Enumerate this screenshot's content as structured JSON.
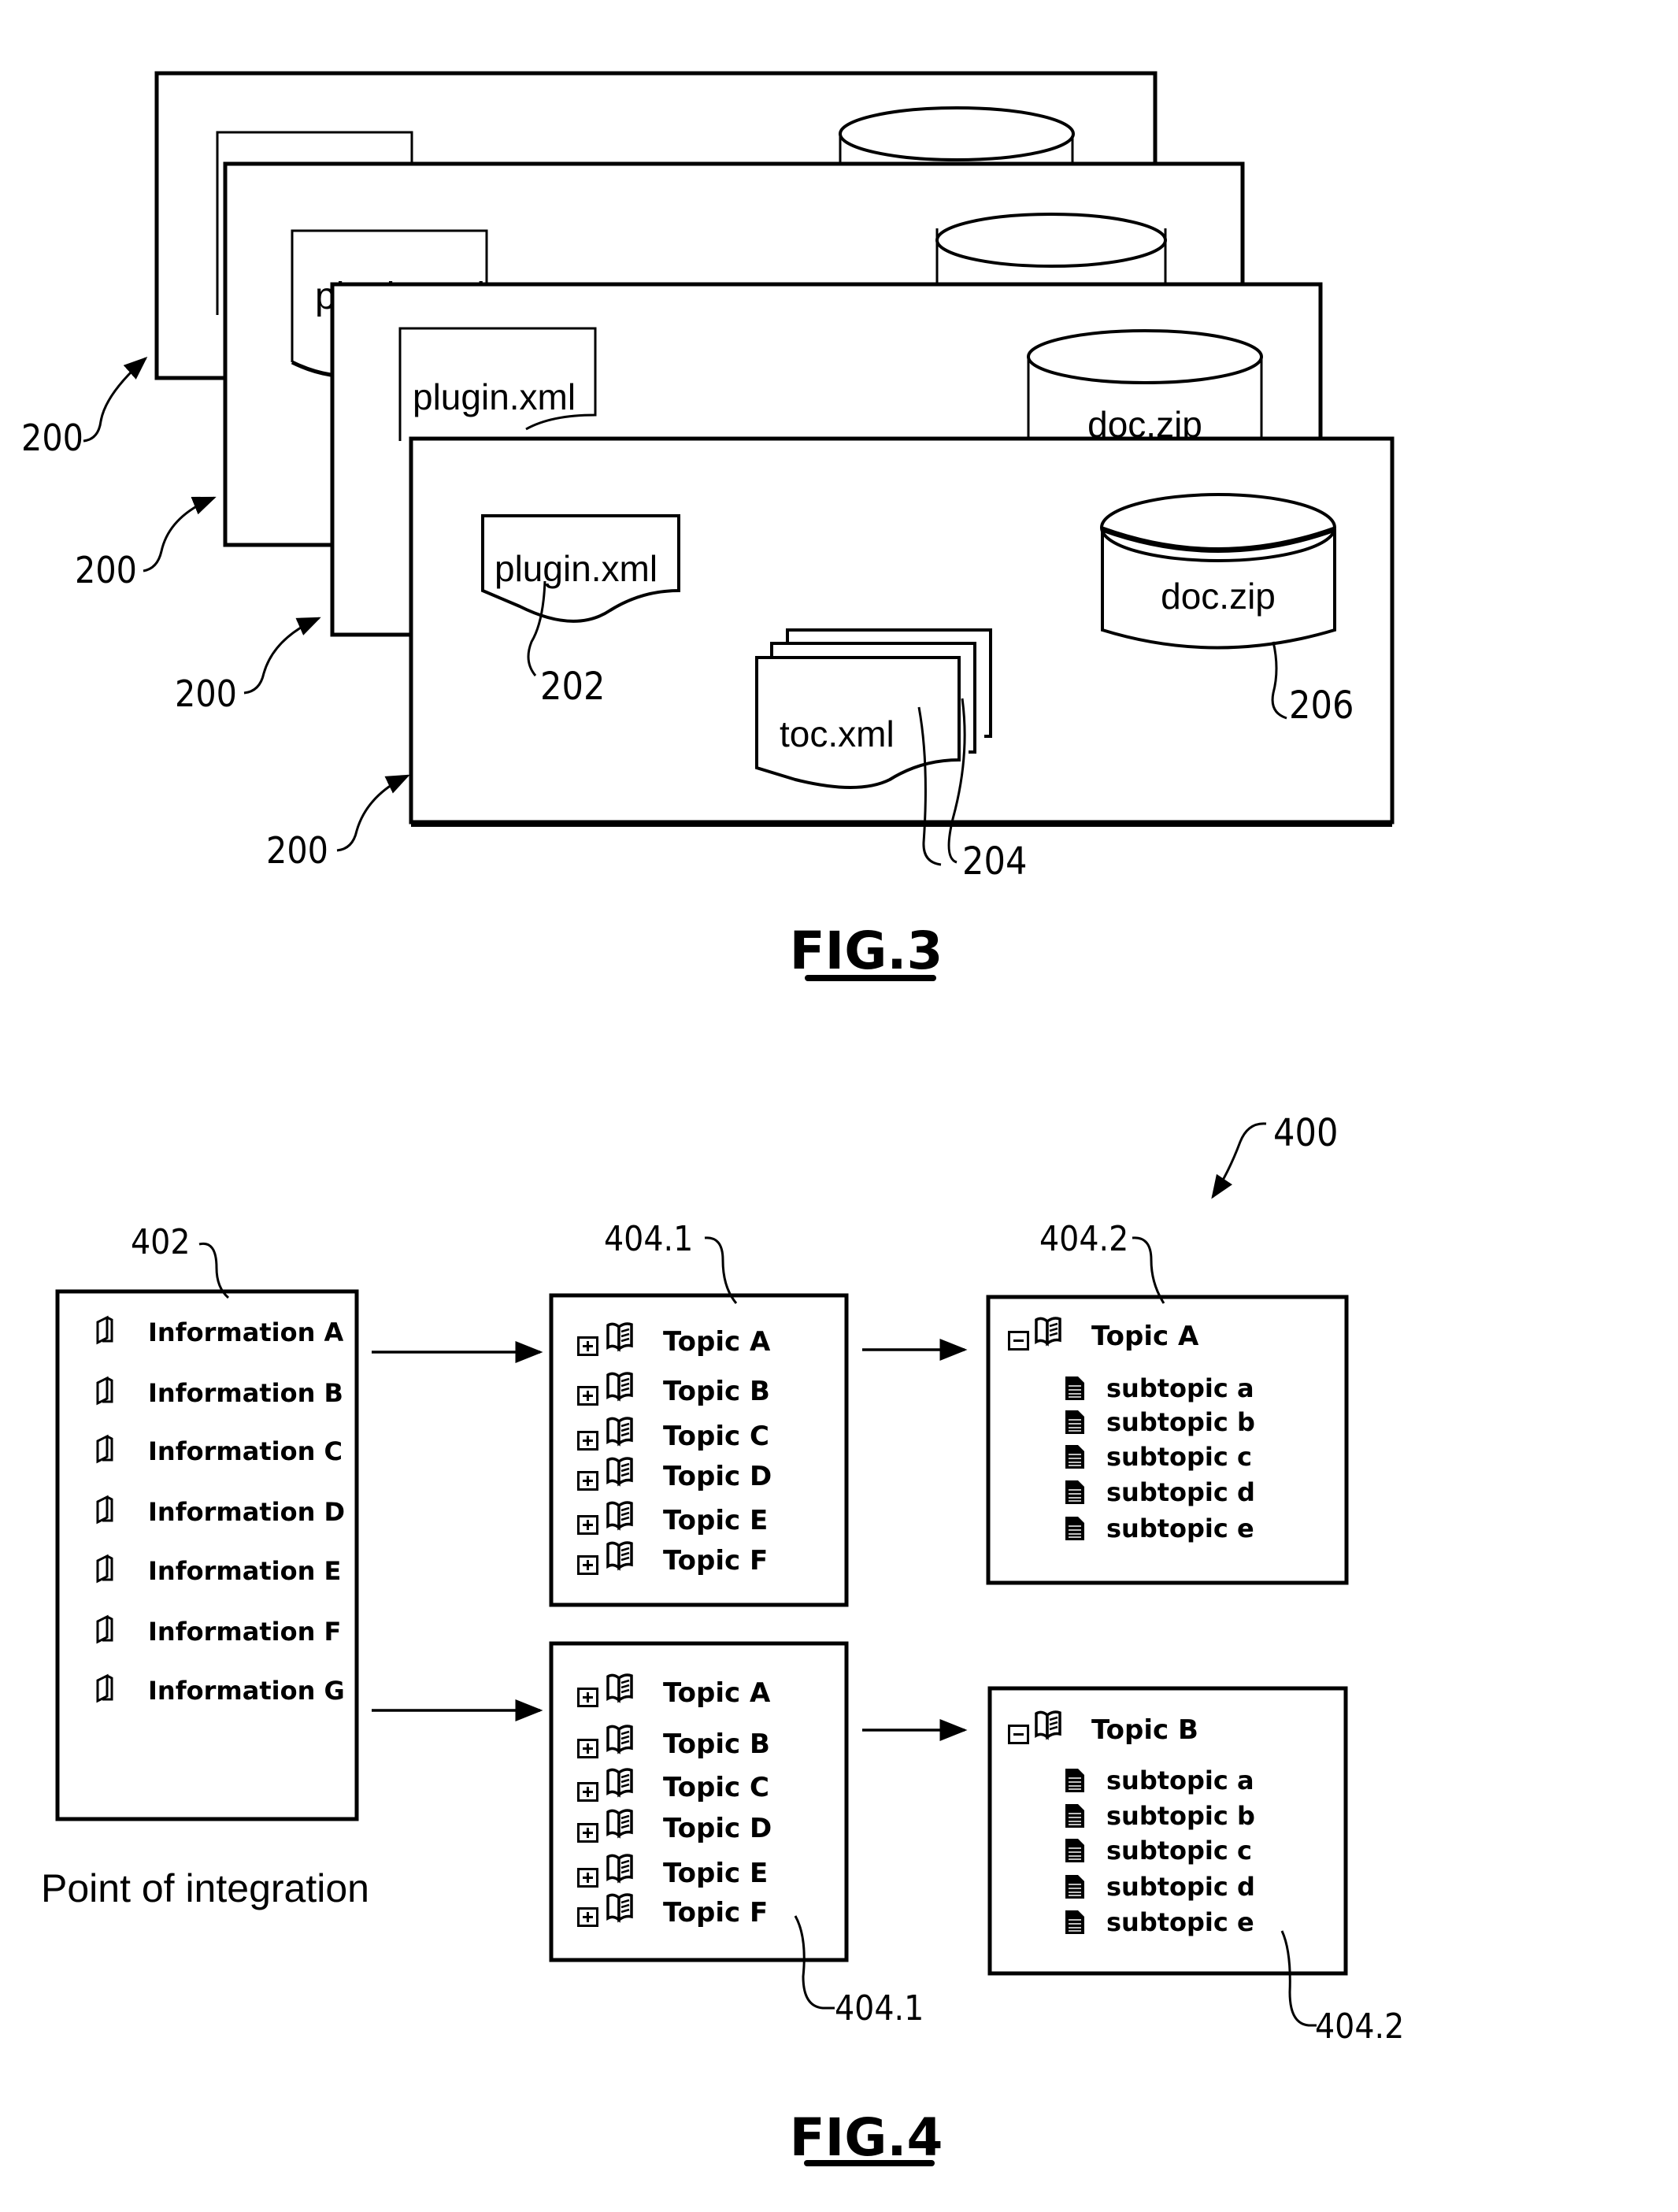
{
  "fig3": {
    "caption": "FIG.3",
    "panels": [
      {
        "ref": "200",
        "plugin_label": "",
        "doc_label": ""
      },
      {
        "ref": "200",
        "plugin_label": "plugin.xml",
        "doc_label": ""
      },
      {
        "ref": "200",
        "plugin_label": "plugin.xml",
        "doc_label": "doc.zip"
      },
      {
        "ref": "200",
        "plugin_label": "plugin.xml",
        "doc_label": "doc.zip",
        "toc_label": "toc.xml"
      }
    ],
    "refs": {
      "plugin": "202",
      "toc": "204",
      "doc": "206"
    }
  },
  "fig4": {
    "caption": "FIG.4",
    "system_ref": "400",
    "integration_box": {
      "ref": "402",
      "caption": "Point of integration",
      "items": [
        "Information A",
        "Information B",
        "Information C",
        "Information D",
        "Information E",
        "Information F",
        "Information G"
      ]
    },
    "toc_level1_top": {
      "ref": "404.1",
      "items": [
        "Topic A",
        "Topic B",
        "Topic C",
        "Topic D",
        "Topic E",
        "Topic F"
      ]
    },
    "toc_level1_bottom": {
      "ref": "404.1",
      "items": [
        "Topic A",
        "Topic B",
        "Topic C",
        "Topic D",
        "Topic E",
        "Topic F"
      ]
    },
    "toc_level2_top": {
      "ref": "404.2",
      "topic": "Topic A",
      "subtopics": [
        "subtopic a",
        "subtopic b",
        "subtopic c",
        "subtopic d",
        "subtopic e"
      ]
    },
    "toc_level2_bottom": {
      "ref": "404.2",
      "topic": "Topic B",
      "subtopics": [
        "subtopic a",
        "subtopic b",
        "subtopic c",
        "subtopic d",
        "subtopic e"
      ]
    }
  }
}
